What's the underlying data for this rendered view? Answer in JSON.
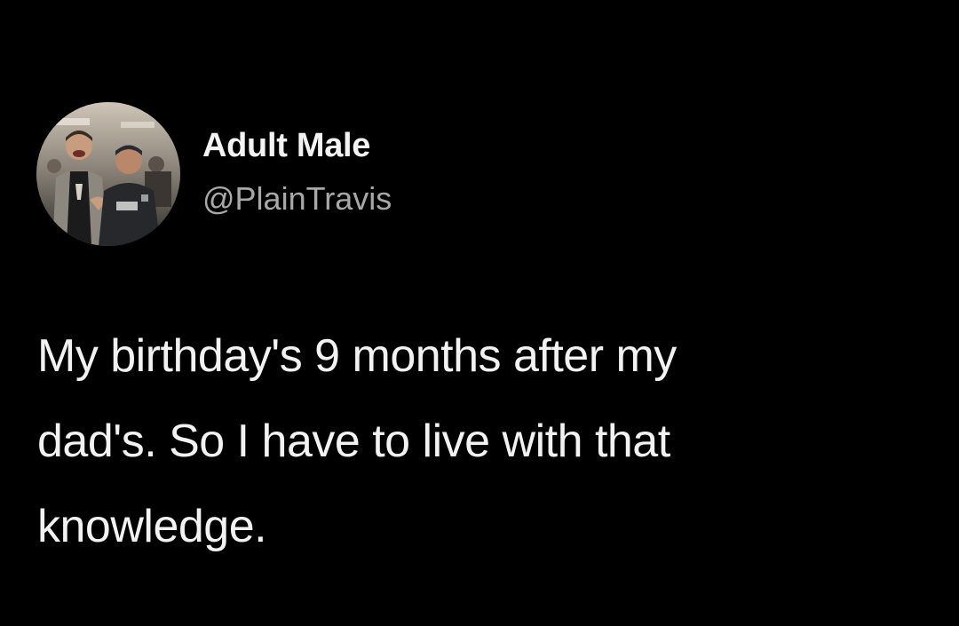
{
  "tweet": {
    "author": {
      "display_name": "Adult Male",
      "handle": "@PlainTravis",
      "avatar_icon": "profile-photo-icon"
    },
    "text_lines": [
      "My birthday's 9 months after my",
      "dad's. So I have to live with that",
      "knowledge."
    ]
  },
  "colors": {
    "background": "#000000",
    "primary_text": "#f2f2f2",
    "secondary_text": "#a8a8a8"
  }
}
